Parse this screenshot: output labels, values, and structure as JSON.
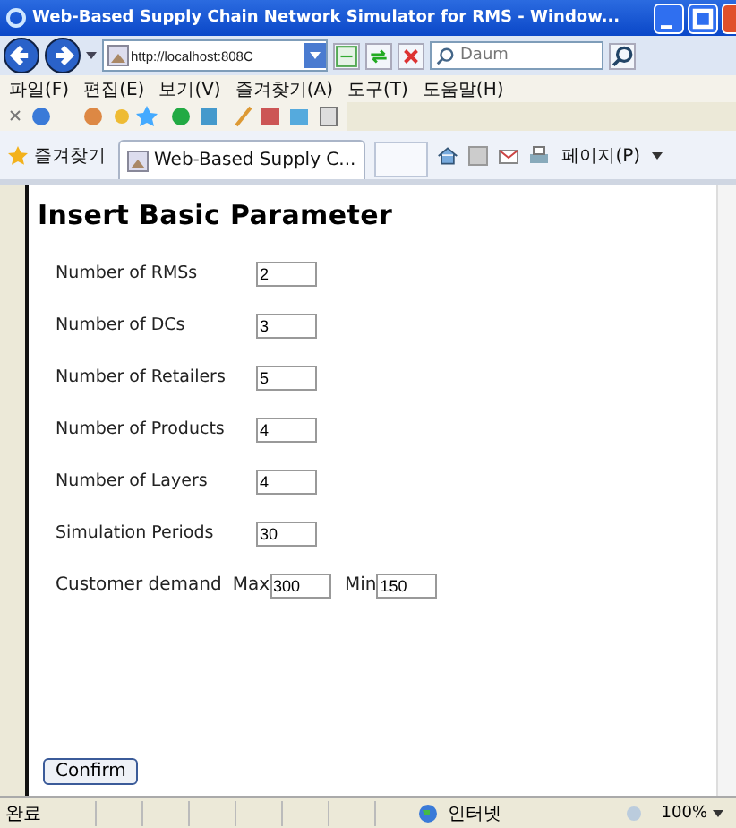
{
  "window": {
    "title": "Web-Based Supply Chain Network Simulator for RMS - Window..."
  },
  "address_bar": {
    "value": "http://localhost:808C"
  },
  "search": {
    "placeholder": "Daum"
  },
  "menu": [
    "파일(F)",
    "편집(E)",
    "보기(V)",
    "즐겨찾기(A)",
    "도구(T)",
    "도움말(H)"
  ],
  "favorites": {
    "label": "즐겨찾기"
  },
  "tabs": [
    {
      "label": "Web-Based Supply C...",
      "selected": true
    }
  ],
  "page_menu": {
    "label": "페이지(P)"
  },
  "form": {
    "heading": "Insert Basic Parameter",
    "fields": [
      {
        "label": "Number of RMSs",
        "value": "2"
      },
      {
        "label": "Number of DCs",
        "value": "3"
      },
      {
        "label": "Number of Retailers",
        "value": "5"
      },
      {
        "label": "Number of Products",
        "value": "4"
      },
      {
        "label": "Number of Layers",
        "value": "4"
      },
      {
        "label": "Simulation Periods",
        "value": "30"
      }
    ],
    "customer_demand": {
      "label": "Customer demand",
      "max_label": "Max",
      "max_value": "300",
      "min_label": "Min",
      "min_value": "150"
    },
    "confirm_button": "Confirm"
  },
  "status_bar": {
    "status": "완료",
    "zone": "인터넷",
    "zoom": "100%"
  }
}
